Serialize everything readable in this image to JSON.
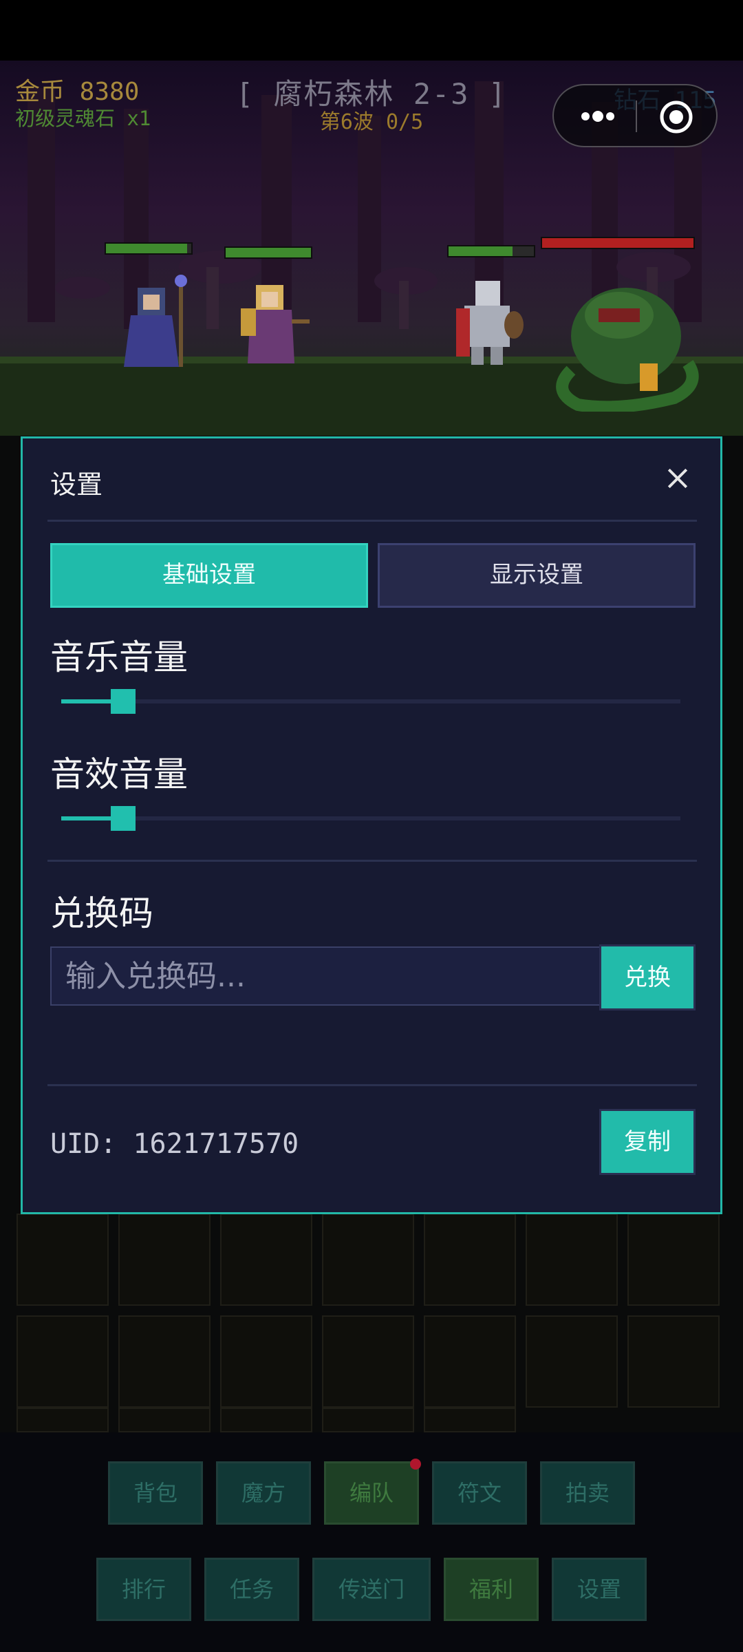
{
  "hud": {
    "gold": "金币 8380",
    "item": "初级灵魂石 x1",
    "stage": "[ 腐朽森林 2-3 ]",
    "wave": "第6波 0/5",
    "diamond": "钻石 115"
  },
  "units": [
    {
      "name": "mage",
      "hp": 0.95,
      "hp_color": "#3f8a2e"
    },
    {
      "name": "archer",
      "hp": 1.0,
      "hp_color": "#3f8a2e"
    },
    {
      "name": "knight",
      "hp": 0.75,
      "hp_color": "#3f8a2e"
    },
    {
      "name": "plant-monster",
      "hp": 1.0,
      "hp_color": "#b22020"
    }
  ],
  "bottom_nav": {
    "row1": [
      "背包",
      "魔方",
      "编队",
      "符文",
      "拍卖"
    ],
    "row2": [
      "排行",
      "任务",
      "传送门",
      "福利",
      "设置"
    ]
  },
  "settings": {
    "title": "设置",
    "tabs": [
      "基础设置",
      "显示设置"
    ],
    "active_tab": "基础设置",
    "music_label": "音乐音量",
    "music_volume": 0.1,
    "sfx_label": "音效音量",
    "sfx_volume": 0.1,
    "redeem_label": "兑换码",
    "redeem_placeholder": "输入兑换码...",
    "redeem_button": "兑换",
    "uid_text": "UID: 1621717570",
    "copy_button": "复制"
  },
  "colors": {
    "accent": "#22bbaa",
    "modal_bg": "#171a32",
    "gold_text": "#a7893c"
  }
}
